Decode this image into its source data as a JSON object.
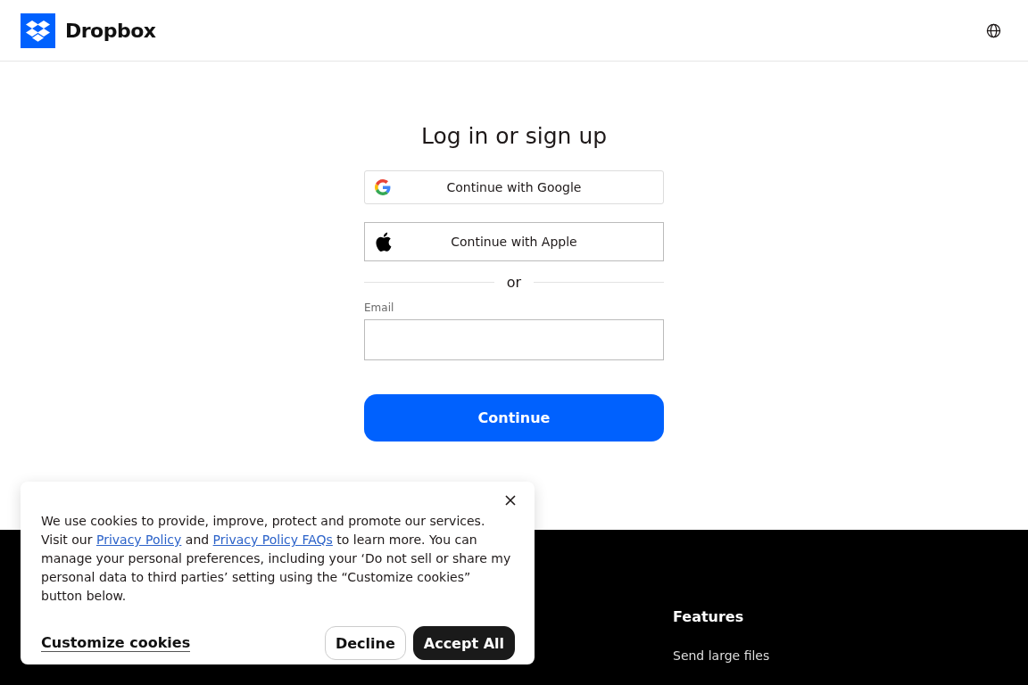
{
  "header": {
    "brand": "Dropbox"
  },
  "login": {
    "title": "Log in or sign up",
    "providers": [
      {
        "kind": "google",
        "label": "Continue with Google"
      },
      {
        "kind": "apple",
        "label": "Continue with Apple"
      }
    ],
    "divider": "or",
    "email": {
      "label": "Email"
    },
    "submit": "Continue"
  },
  "footer": {
    "columns": [
      {
        "heading": "Features",
        "links": [
          "Send large files"
        ]
      }
    ]
  },
  "cookie_banner": {
    "text_parts": [
      {
        "kind": "text",
        "text": "We use cookies to provide, improve, protect and promote our services. Visit our "
      },
      {
        "kind": "link",
        "text": "Privacy Policy"
      },
      {
        "kind": "text",
        "text": " and "
      },
      {
        "kind": "link",
        "text": "Privacy Policy FAQs"
      },
      {
        "kind": "text",
        "text": " to learn more. You can manage your personal preferences, including your ‘Do not sell or share my personal data to third parties’ setting using the “Customize cookies” button below."
      }
    ],
    "customize": "Customize cookies",
    "buttons": [
      {
        "kind": "secondary",
        "label": "Decline"
      },
      {
        "kind": "primary",
        "label": "Accept All"
      }
    ]
  }
}
